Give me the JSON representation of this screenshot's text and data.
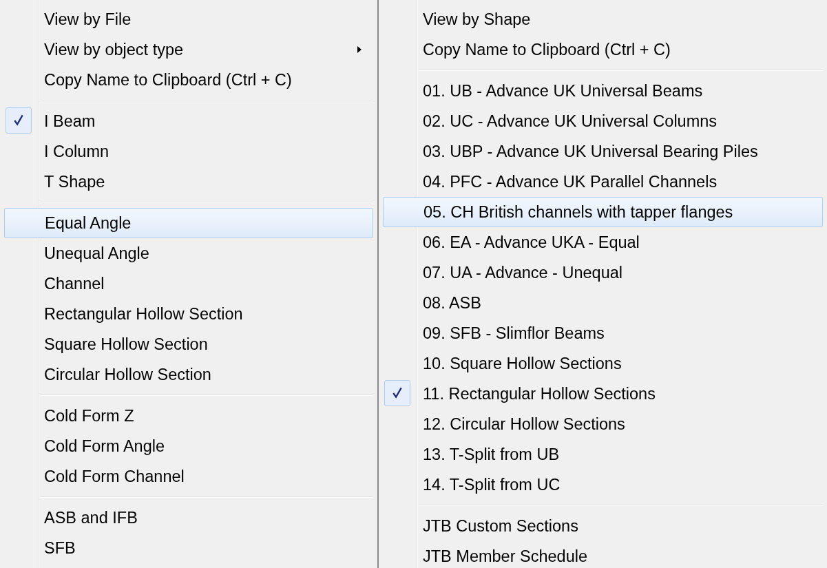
{
  "menus": [
    {
      "items": [
        {
          "kind": "item",
          "label": "View by File",
          "checked": false,
          "selected": false,
          "has_submenu": false
        },
        {
          "kind": "item",
          "label": "View by object type",
          "checked": false,
          "selected": false,
          "has_submenu": true
        },
        {
          "kind": "item",
          "label": "Copy Name to Clipboard (Ctrl + C)",
          "checked": false,
          "selected": false,
          "has_submenu": false
        },
        {
          "kind": "separator"
        },
        {
          "kind": "item",
          "label": "I Beam",
          "checked": true,
          "selected": false,
          "has_submenu": false
        },
        {
          "kind": "item",
          "label": "I Column",
          "checked": false,
          "selected": false,
          "has_submenu": false
        },
        {
          "kind": "item",
          "label": "T Shape",
          "checked": false,
          "selected": false,
          "has_submenu": false
        },
        {
          "kind": "separator"
        },
        {
          "kind": "item",
          "label": "Equal Angle",
          "checked": false,
          "selected": true,
          "has_submenu": false
        },
        {
          "kind": "item",
          "label": "Unequal Angle",
          "checked": false,
          "selected": false,
          "has_submenu": false
        },
        {
          "kind": "item",
          "label": "Channel",
          "checked": false,
          "selected": false,
          "has_submenu": false
        },
        {
          "kind": "item",
          "label": "Rectangular Hollow Section",
          "checked": false,
          "selected": false,
          "has_submenu": false
        },
        {
          "kind": "item",
          "label": "Square Hollow Section",
          "checked": false,
          "selected": false,
          "has_submenu": false
        },
        {
          "kind": "item",
          "label": "Circular Hollow Section",
          "checked": false,
          "selected": false,
          "has_submenu": false
        },
        {
          "kind": "separator"
        },
        {
          "kind": "item",
          "label": "Cold Form Z",
          "checked": false,
          "selected": false,
          "has_submenu": false
        },
        {
          "kind": "item",
          "label": "Cold Form Angle",
          "checked": false,
          "selected": false,
          "has_submenu": false
        },
        {
          "kind": "item",
          "label": "Cold Form Channel",
          "checked": false,
          "selected": false,
          "has_submenu": false
        },
        {
          "kind": "separator"
        },
        {
          "kind": "item",
          "label": "ASB and IFB",
          "checked": false,
          "selected": false,
          "has_submenu": false
        },
        {
          "kind": "item",
          "label": "SFB",
          "checked": false,
          "selected": false,
          "has_submenu": false
        }
      ]
    },
    {
      "items": [
        {
          "kind": "item",
          "label": "View by Shape",
          "checked": false,
          "selected": false,
          "has_submenu": false
        },
        {
          "kind": "item",
          "label": "Copy Name to Clipboard (Ctrl + C)",
          "checked": false,
          "selected": false,
          "has_submenu": false
        },
        {
          "kind": "separator"
        },
        {
          "kind": "item",
          "label": "01. UB - Advance UK Universal Beams",
          "checked": false,
          "selected": false,
          "has_submenu": false
        },
        {
          "kind": "item",
          "label": "02. UC - Advance UK Universal Columns",
          "checked": false,
          "selected": false,
          "has_submenu": false
        },
        {
          "kind": "item",
          "label": "03. UBP - Advance UK Universal Bearing Piles",
          "checked": false,
          "selected": false,
          "has_submenu": false
        },
        {
          "kind": "item",
          "label": "04. PFC - Advance UK Parallel Channels",
          "checked": false,
          "selected": false,
          "has_submenu": false
        },
        {
          "kind": "item",
          "label": "05. CH British channels with tapper flanges",
          "checked": false,
          "selected": true,
          "has_submenu": false
        },
        {
          "kind": "item",
          "label": "06. EA - Advance UKA - Equal",
          "checked": false,
          "selected": false,
          "has_submenu": false
        },
        {
          "kind": "item",
          "label": "07. UA - Advance - Unequal",
          "checked": false,
          "selected": false,
          "has_submenu": false
        },
        {
          "kind": "item",
          "label": "08. ASB",
          "checked": false,
          "selected": false,
          "has_submenu": false
        },
        {
          "kind": "item",
          "label": "09. SFB - Slimflor Beams",
          "checked": false,
          "selected": false,
          "has_submenu": false
        },
        {
          "kind": "item",
          "label": "10. Square Hollow Sections",
          "checked": false,
          "selected": false,
          "has_submenu": false
        },
        {
          "kind": "item",
          "label": "11. Rectangular Hollow Sections",
          "checked": true,
          "selected": false,
          "has_submenu": false
        },
        {
          "kind": "item",
          "label": "12. Circular Hollow Sections",
          "checked": false,
          "selected": false,
          "has_submenu": false
        },
        {
          "kind": "item",
          "label": "13. T-Split from UB",
          "checked": false,
          "selected": false,
          "has_submenu": false
        },
        {
          "kind": "item",
          "label": "14. T-Split from UC",
          "checked": false,
          "selected": false,
          "has_submenu": false
        },
        {
          "kind": "separator"
        },
        {
          "kind": "item",
          "label": "JTB Custom Sections",
          "checked": false,
          "selected": false,
          "has_submenu": false
        },
        {
          "kind": "item",
          "label": "JTB Member Schedule",
          "checked": false,
          "selected": false,
          "has_submenu": false
        }
      ]
    }
  ]
}
